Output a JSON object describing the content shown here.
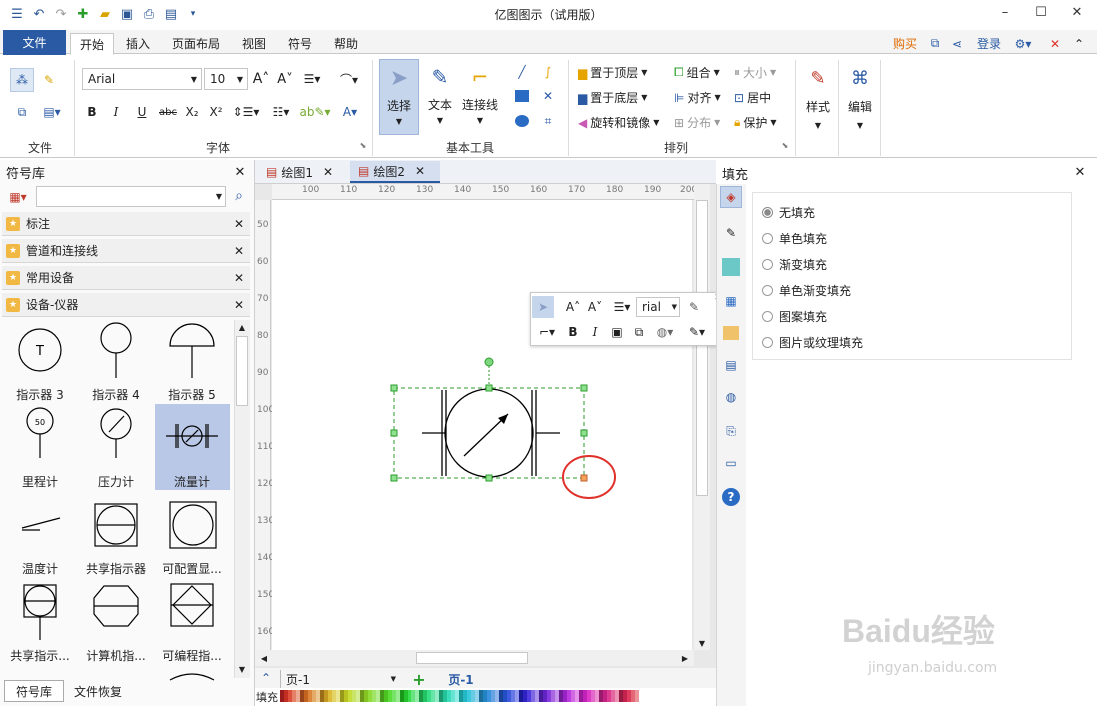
{
  "window": {
    "title": "亿图图示（试用版）",
    "minimize": "–",
    "maximize": "☐",
    "close": "✕"
  },
  "menu": {
    "file": "文件",
    "tabs": [
      "开始",
      "插入",
      "页面布局",
      "视图",
      "符号",
      "帮助"
    ],
    "right": {
      "buy": "购买",
      "login": "登录"
    }
  },
  "ribbon": {
    "groups": {
      "file": "文件",
      "font": "字体",
      "basic_tools": "基本工具",
      "arrange": "排列"
    },
    "font_name": "Arial",
    "font_size": "10",
    "tools": {
      "select": "选择",
      "text": "文本",
      "connector": "连接线"
    },
    "arrange": {
      "bring_front": "置于顶层",
      "send_back": "置于底层",
      "rotate_mirror": "旋转和镜像",
      "group": "组合",
      "align": "对齐",
      "distribute": "分布",
      "size": "大小",
      "center": "居中",
      "protect": "保护"
    },
    "style": "样式",
    "edit": "编辑"
  },
  "library": {
    "title": "符号库",
    "search_placeholder": "",
    "categories": [
      "标注",
      "管道和连接线",
      "常用设备",
      "设备-仪器"
    ],
    "symbols": [
      [
        "指示器 3",
        "指示器 4",
        "指示器 5"
      ],
      [
        "里程计",
        "压力计",
        "流量计"
      ],
      [
        "温度计",
        "共享指示器",
        "可配置显..."
      ],
      [
        "共享指示...",
        "计算机指...",
        "可编程指..."
      ]
    ],
    "odometer_value": "50",
    "indicator3_letter": "T",
    "bottom_tabs": [
      "符号库",
      "文件恢复"
    ]
  },
  "documents": {
    "tabs": [
      "绘图1",
      "绘图2"
    ]
  },
  "rulers": {
    "h": [
      "100",
      "110",
      "120",
      "130",
      "140",
      "150",
      "160",
      "170",
      "180",
      "190",
      "200"
    ],
    "v": [
      "50",
      "60",
      "70",
      "80",
      "90",
      "100",
      "110",
      "120",
      "130",
      "140",
      "150",
      "160"
    ]
  },
  "floating_toolbar": {
    "font": "rial"
  },
  "pages": {
    "current": "页-1",
    "tab": "页-1",
    "fill_label": "填充"
  },
  "fill_panel": {
    "title": "填充",
    "options": [
      "无填充",
      "单色填充",
      "渐变填充",
      "单色渐变填充",
      "图案填充",
      "图片或纹理填充"
    ],
    "selected": 0
  },
  "watermark": {
    "logo": "Baidu经验",
    "url": "jingyan.baidu.com"
  },
  "colors": {
    "accent": "#2a5aa4",
    "selection": "#2a9d2a",
    "highlight_circle": "#e0302a",
    "ribbon_bg": "#f4f4f4"
  }
}
